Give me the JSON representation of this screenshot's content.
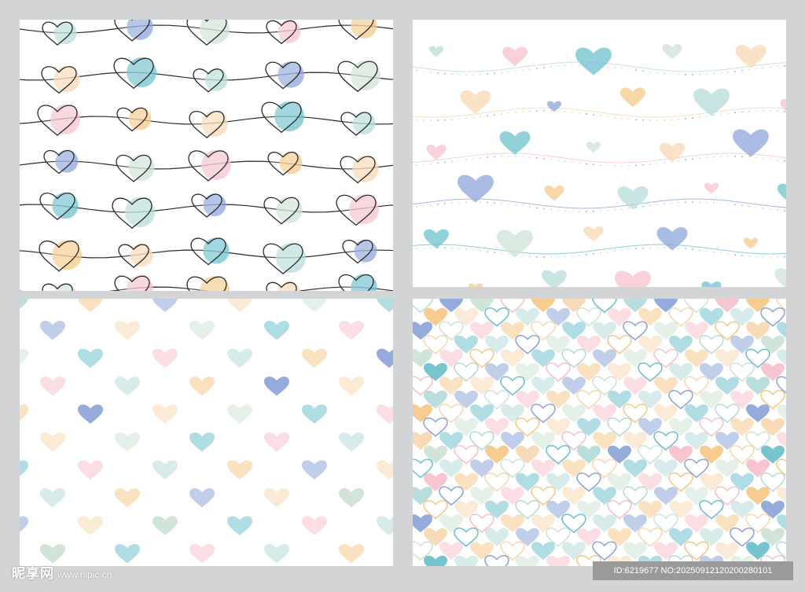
{
  "panels": [
    {
      "id": "p1",
      "style": "outlined-hearts-on-strings"
    },
    {
      "id": "p2",
      "style": "soft-hearts-on-dotted-waves"
    },
    {
      "id": "p3",
      "style": "scattered-pastel-hearts"
    },
    {
      "id": "p4",
      "style": "dense-doodle-hearts"
    }
  ],
  "palette": {
    "mint": "#b6dcd9",
    "peach": "#f7d8b3",
    "pink": "#f5c2cc",
    "blue": "#8ea6d9",
    "teal": "#6fc1ce",
    "yellow": "#f5c98a",
    "sage": "#cfe3d6",
    "line": "#2a2a2a"
  },
  "watermark": {
    "brand": "昵享网",
    "url": "www.nipic.cn"
  },
  "id_tag": "ID:6219677 NO:20250912120200280101"
}
